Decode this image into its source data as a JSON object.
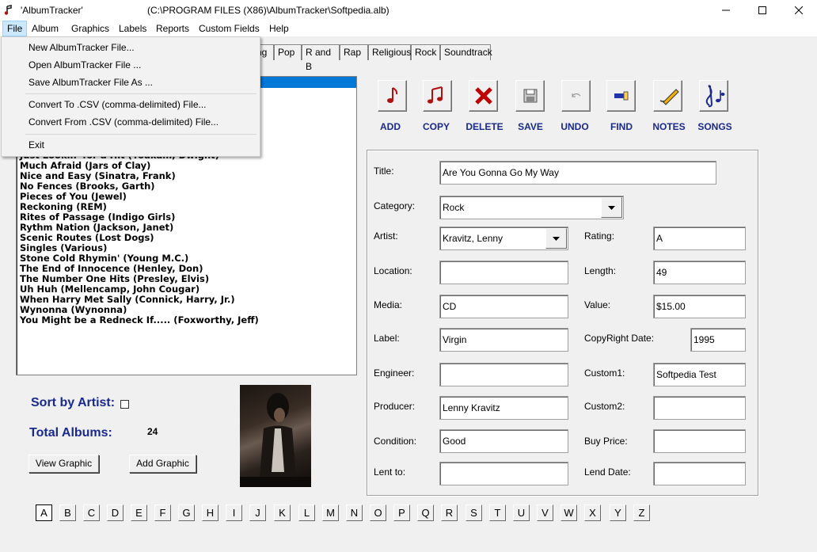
{
  "window": {
    "app_title": "'AlbumTracker'",
    "file_path": "(C:\\PROGRAM FILES (X86)\\AlbumTracker\\Softpedia.alb)"
  },
  "menubar": [
    "File",
    "Album",
    "Graphics",
    "Labels",
    "Reports",
    "Custom Fields",
    "Help"
  ],
  "file_menu": {
    "items": [
      "New AlbumTracker File...",
      "Open AlbumTracker File ...",
      "Save AlbumTracker File As ...",
      "Convert To .CSV (comma-delimited) File...",
      "Convert From .CSV (comma-delimited) File...",
      "Exit"
    ]
  },
  "tabs": [
    "ng",
    "Pop",
    "R and B",
    "Rap",
    "Religious",
    "Rock",
    "Soundtrack"
  ],
  "album_list": [
    "Just Lookin' for a Hit (Yoakam, Dwight)",
    "Much Afraid (Jars of Clay)",
    "Nice and Easy (Sinatra, Frank)",
    "No Fences (Brooks, Garth)",
    "Pieces of You (Jewel)",
    "Reckoning (REM)",
    "Rites of Passage (Indigo Girls)",
    "Rythm Nation (Jackson, Janet)",
    "Scenic Routes (Lost Dogs)",
    "Singles (Various)",
    "Stone Cold Rhymin' (Young M.C.)",
    "The End of Innocence (Henley, Don)",
    "The Number One Hits (Presley, Elvis)",
    "Uh Huh (Mellencamp, John Cougar)",
    "When Harry Met Sally (Connick, Harry, Jr.)",
    "Wynonna (Wynonna)",
    "You Might be a Redneck If..... (Foxworthy, Jeff)"
  ],
  "toolbar": {
    "add": "ADD",
    "copy": "COPY",
    "delete": "DELETE",
    "save": "SAVE",
    "undo": "UNDO",
    "find": "FIND",
    "notes": "NOTES",
    "songs": "SONGS"
  },
  "form": {
    "labels": {
      "title": "Title:",
      "category": "Category:",
      "artist": "Artist:",
      "rating": "Rating:",
      "location": "Location:",
      "length": "Length:",
      "media": "Media:",
      "value": "Value:",
      "label": "Label:",
      "copyright": "CopyRight Date:",
      "engineer": "Engineer:",
      "custom1": "Custom1:",
      "producer": "Producer:",
      "custom2": "Custom2:",
      "condition": "Condition:",
      "buy_price": "Buy Price:",
      "lent_to": "Lent to:",
      "lend_date": "Lend Date:"
    },
    "values": {
      "title": "Are You Gonna Go My Way",
      "category": "Rock",
      "artist": "Kravitz, Lenny",
      "rating": "A",
      "location": "",
      "length": "49",
      "media": "CD",
      "value": "$15.00",
      "label": "Virgin",
      "copyright": "1995",
      "engineer": "",
      "custom1": "Softpedia Test",
      "producer": "Lenny Kravitz",
      "custom2": "",
      "condition": "Good",
      "buy_price": "",
      "lent_to": "",
      "lend_date": ""
    }
  },
  "bottom": {
    "sort_label": "Sort by Artist:",
    "total_label": "Total Albums:",
    "total_count": "24",
    "view_graphic": "View Graphic",
    "add_graphic": "Add Graphic"
  },
  "alphabet": [
    "A",
    "B",
    "C",
    "D",
    "E",
    "F",
    "G",
    "H",
    "I",
    "J",
    "K",
    "L",
    "M",
    "N",
    "O",
    "P",
    "Q",
    "R",
    "S",
    "T",
    "U",
    "V",
    "W",
    "X",
    "Y",
    "Z"
  ],
  "selected_letter": "A",
  "colors": {
    "accent_blue": "#1a2a8c",
    "selection": "#0078d7",
    "icon_red": "#b01010"
  }
}
